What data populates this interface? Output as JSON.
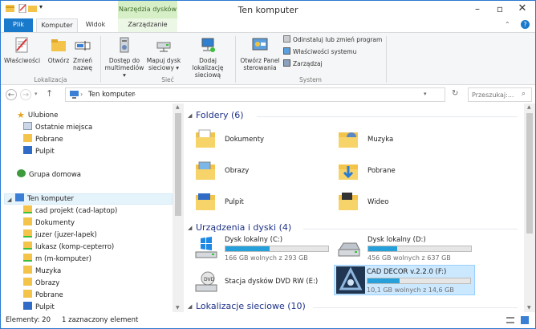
{
  "window": {
    "title": "Ten komputer"
  },
  "ribbon_tabs": {
    "context_title": "Narzędzia dysków",
    "file": "Plik",
    "computer": "Komputer",
    "view": "Widok",
    "manage": "Zarządzanie"
  },
  "ribbon": {
    "location": {
      "properties": "Właściwości",
      "open": "Otwórz",
      "rename_l1": "Zmień",
      "rename_l2": "nazwę",
      "group": "Lokalizacja"
    },
    "network": {
      "media_l1": "Dostęp do",
      "media_l2": "multimediów ▾",
      "map_l1": "Mapuj dysk",
      "map_l2": "sieciowy ▾",
      "addloc_l1": "Dodaj lokalizację",
      "addloc_l2": "sieciową",
      "group": "Sieć"
    },
    "system": {
      "panel_l1": "Otwórz Panel",
      "panel_l2": "sterowania",
      "uninstall": "Odinstaluj lub zmień program",
      "sysprops": "Właściwości systemu",
      "manage": "Zarządzaj",
      "group": "System"
    }
  },
  "address": {
    "path": "Ten komputer",
    "search_placeholder": "Przeszukaj:..."
  },
  "nav": {
    "favorites": "Ulubione",
    "recent": "Ostatnie miejsca",
    "downloads": "Pobrane",
    "desktop": "Pulpit",
    "homegroup": "Grupa domowa",
    "computer": "Ten komputer",
    "items": [
      "cad projekt (cad-laptop)",
      "Dokumenty",
      "juzer (juzer-lapek)",
      "lukasz (komp-cepterro)",
      "m (m-komputer)",
      "Muzyka",
      "Obrazy",
      "Pobrane",
      "Pulpit"
    ]
  },
  "content": {
    "folders_header": "Foldery (6)",
    "folders": [
      "Dokumenty",
      "Muzyka",
      "Obrazy",
      "Pobrane",
      "Pulpit",
      "Wideo"
    ],
    "devices_header": "Urządzenia i dyski (4)",
    "drives": [
      {
        "name": "Dysk lokalny (C:)",
        "free": "166 GB wolnych z 293 GB",
        "used_fraction": 0.43
      },
      {
        "name": "Dysk lokalny (D:)",
        "free": "456 GB wolnych z 637 GB",
        "used_fraction": 0.28
      },
      {
        "name": "Stacja dysków DVD RW (E:)"
      },
      {
        "name": "CAD DECOR v.2.2.0 (F:)",
        "free": "10,1 GB wolnych z 14,6 GB",
        "used_fraction": 0.31
      }
    ],
    "network_header": "Lokalizacje sieciowe (10)"
  },
  "status": {
    "count": "Elementy: 20",
    "selected": "1 zaznaczony element"
  }
}
